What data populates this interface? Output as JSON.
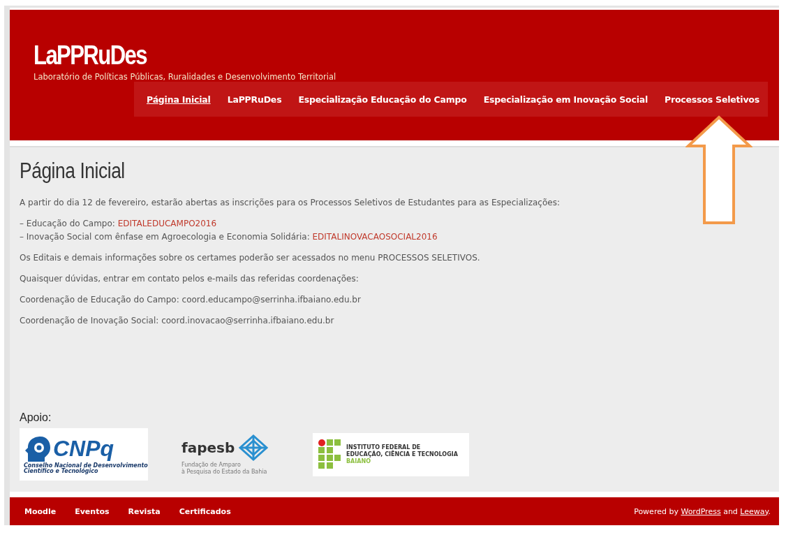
{
  "site": {
    "title": "LaPPRuDes",
    "tagline": "Laboratório de Políticas Públicas, Ruralidades e Desenvolvimento Territorial"
  },
  "nav": [
    {
      "label": "Página Inicial",
      "selected": true
    },
    {
      "label": "LaPPRuDes",
      "selected": false
    },
    {
      "label": "Especialização Educação do Campo",
      "selected": false
    },
    {
      "label": "Especialização em Inovação Social",
      "selected": false
    },
    {
      "label": "Processos Seletivos",
      "selected": false
    }
  ],
  "page": {
    "heading": "Página Inicial",
    "blocks": [
      [
        {
          "text": "A partir do dia 12 de fevereiro, estarão abertas as inscrições para os Processos Seletivos de Estudantes para as Especializações:"
        }
      ],
      [
        {
          "text": "– Educação do Campo: ",
          "link": "EDITALEDUCAMPO2016"
        },
        {
          "text": "– Inovação Social com ênfase em Agroecologia e Economia Solidária: ",
          "link": "EDITALINOVACAOSOCIAL2016"
        }
      ],
      [
        {
          "text": "Os Editais e demais informações sobre os certames poderão ser acessados no menu PROCESSOS SELETIVOS."
        }
      ],
      [
        {
          "text": "Quaisquer dúvidas, entrar em contato pelos e-mails das referidas coordenações:"
        }
      ],
      [
        {
          "text": "Coordenação de Educação do Campo: coord.educampo@serrinha.ifbaiano.edu.br"
        }
      ],
      [
        {
          "text": "Coordenação de Inovação Social: coord.inovacao@serrinha.ifbaiano.edu.br"
        }
      ]
    ]
  },
  "support": {
    "label": "Apoio:",
    "logos": [
      {
        "kind": "cnpq",
        "name": "CNPq",
        "caption": [
          "Conselho Nacional de Desenvolvimento",
          "Científico e Tecnológico"
        ]
      },
      {
        "kind": "fapesb",
        "name": "fapesb",
        "caption": [
          "Fundação de Amparo",
          "à Pesquisa do Estado da Bahia"
        ]
      },
      {
        "kind": "if",
        "caption": [
          "INSTITUTO FEDERAL DE",
          "EDUCAÇÃO, CIÊNCIA E TECNOLOGIA",
          "BAIANO"
        ]
      }
    ]
  },
  "footer": {
    "links": [
      "Moodle",
      "Eventos",
      "Revista",
      "Certificados"
    ],
    "credit": {
      "before": "Powered by ",
      "link1": "WordPress",
      "between": " and ",
      "link2": "Leeway",
      "after": "."
    }
  }
}
